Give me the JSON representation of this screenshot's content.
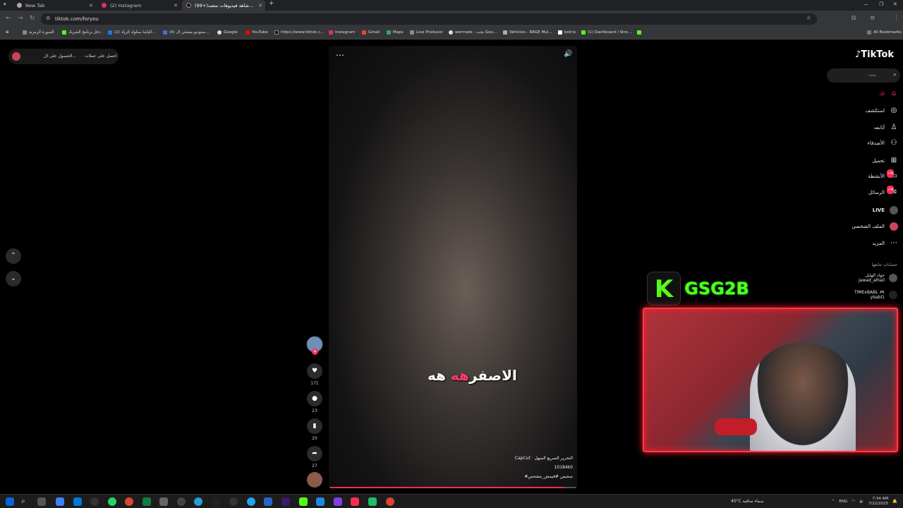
{
  "browser": {
    "tabs": [
      {
        "title": "New Tab",
        "active": false
      },
      {
        "title": "(2) Instagram",
        "active": false
      },
      {
        "title": "(99+)شاهد فيديوهات متصد...",
        "active": true
      }
    ],
    "new_tab": "+",
    "url": "tiktok.com/foryou",
    "bookmarks": [
      "الصورة الرمزية",
      "دخل برنامج الشريك",
      "(2) الياشا سكواد الرياد...",
      "(4) ستوديو منشئي ال...",
      "Google",
      "YouTube",
      "https://www.tiktok.c...",
      "Instagram",
      "Gmail",
      "Maps",
      "Live Producer",
      "wormate - بحث Goo...",
      "Vehicles - RAGE Mul...",
      "botrix",
      "(1) Dashboard / Stre..."
    ],
    "all_bookmarks": "All Bookmarks"
  },
  "tiktok": {
    "logo": "TikTok",
    "search_placeholder": "بحث",
    "get_app_1": "الحصول على ال...",
    "get_app_2": "احصل على عملات",
    "nav": [
      {
        "label": "لك",
        "icon": "home-icon"
      },
      {
        "label": "استكشف",
        "icon": "compass-icon"
      },
      {
        "label": "أتابعه",
        "icon": "following-icon"
      },
      {
        "label": "الأصدقاء",
        "icon": "friends-icon"
      },
      {
        "label": "تحميل",
        "icon": "upload-icon"
      },
      {
        "label": "الأنشطة",
        "icon": "activity-icon",
        "badge": "99+"
      },
      {
        "label": "الرسائل",
        "icon": "messages-icon",
        "badge": "99+"
      },
      {
        "label": "LIVE",
        "icon": "live-icon"
      },
      {
        "label": "الملف الشخصي",
        "icon": "profile-icon"
      },
      {
        "label": "المزيد",
        "icon": "more-icon"
      }
    ],
    "following_title": "حسابات تتابعها",
    "following": [
      {
        "name": "جواد الهايل",
        "handle": "jawad_alhail"
      },
      {
        "name": "TIMExBABL 🎮",
        "handle": "ybabl1"
      }
    ],
    "video": {
      "caption_white": "الاصفر",
      "caption_pink": "هه",
      "caption_tail": "هه",
      "capcut_line": "CapCut · التحرير السريع السهل",
      "author_id": "10184k0",
      "desc": "#صحيص #قيمش_مشحص",
      "progress": 0.95
    },
    "actions": [
      {
        "name": "like-button",
        "icon": "♥",
        "count": "171"
      },
      {
        "name": "comment-button",
        "icon": "●",
        "count": "23"
      },
      {
        "name": "bookmark-button",
        "icon": "▮",
        "count": "20"
      },
      {
        "name": "share-button",
        "icon": "➦",
        "count": "27"
      }
    ]
  },
  "overlay": {
    "kick_letter": "K",
    "handle": "GSG2B"
  },
  "taskbar": {
    "weather": "40°C  سماء صافية",
    "lang": "ENG",
    "time": "7:34 AM",
    "date": "7/22/2025"
  }
}
